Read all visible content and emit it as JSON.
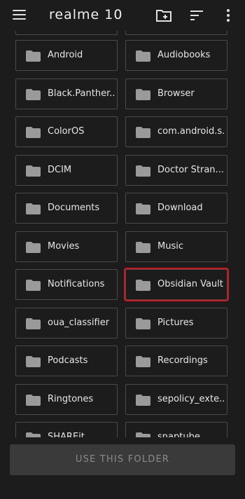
{
  "header": {
    "title": "realme 10"
  },
  "folders": [
    "Android",
    "Audiobooks",
    "Black.Panther...",
    "Browser",
    "ColorOS",
    "com.android.s...",
    "DCIM",
    "Doctor Stran...",
    "Documents",
    "Download",
    "Movies",
    "Music",
    "Notifications",
    "Obsidian Vault",
    "oua_classifier",
    "Pictures",
    "Podcasts",
    "Recordings",
    "Ringtones",
    "sepolicy_exte...",
    "SHAREit",
    "snaptube"
  ],
  "highlighted_folder": "Obsidian Vault",
  "highlight_color": "#d8141e",
  "footer": {
    "use_folder_label": "USE THIS FOLDER"
  }
}
